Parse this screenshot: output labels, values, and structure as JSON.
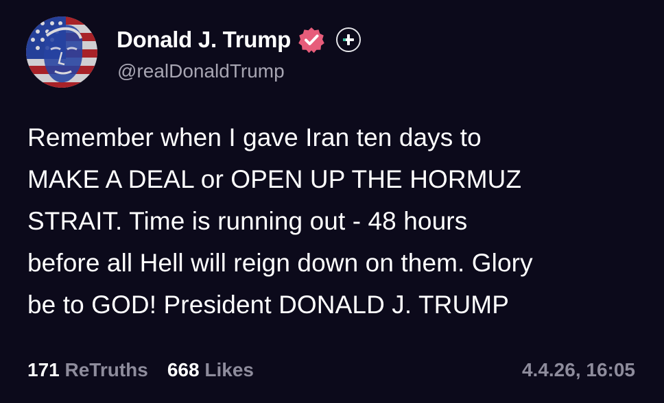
{
  "author": {
    "display_name": "Donald J. Trump",
    "handle": "@realDonaldTrump",
    "avatar_icon": "flag-portrait-avatar",
    "verified_icon": "verified-badge-icon",
    "follow_icon": "plus-icon"
  },
  "post": {
    "lines": [
      "Remember when I gave Iran ten days to",
      "MAKE A DEAL or OPEN UP THE HORMUZ",
      "STRAIT. Time is running out - 48 hours",
      "before all Hell will reign down on them. Glory",
      "be to GOD! President DONALD J. TRUMP"
    ]
  },
  "stats": {
    "retruths_count": "171",
    "retruths_label": "ReTruths",
    "likes_count": "668",
    "likes_label": "Likes"
  },
  "timestamp": "4.4.26, 16:05",
  "colors": {
    "background": "#0c0a1b",
    "muted_text": "#8e8c9c",
    "verified_badge": "#e75c7a",
    "follow_accent": "#3ec7a6"
  }
}
